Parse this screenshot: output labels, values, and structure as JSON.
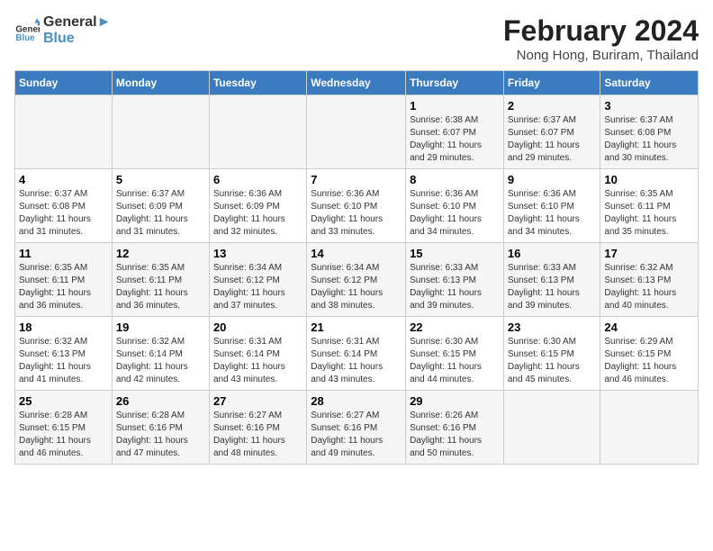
{
  "header": {
    "logo_line1": "General",
    "logo_line2": "Blue",
    "month_year": "February 2024",
    "location": "Nong Hong, Buriram, Thailand"
  },
  "days_of_week": [
    "Sunday",
    "Monday",
    "Tuesday",
    "Wednesday",
    "Thursday",
    "Friday",
    "Saturday"
  ],
  "weeks": [
    [
      {
        "day": "",
        "info": ""
      },
      {
        "day": "",
        "info": ""
      },
      {
        "day": "",
        "info": ""
      },
      {
        "day": "",
        "info": ""
      },
      {
        "day": "1",
        "info": "Sunrise: 6:38 AM\nSunset: 6:07 PM\nDaylight: 11 hours\nand 29 minutes."
      },
      {
        "day": "2",
        "info": "Sunrise: 6:37 AM\nSunset: 6:07 PM\nDaylight: 11 hours\nand 29 minutes."
      },
      {
        "day": "3",
        "info": "Sunrise: 6:37 AM\nSunset: 6:08 PM\nDaylight: 11 hours\nand 30 minutes."
      }
    ],
    [
      {
        "day": "4",
        "info": "Sunrise: 6:37 AM\nSunset: 6:08 PM\nDaylight: 11 hours\nand 31 minutes."
      },
      {
        "day": "5",
        "info": "Sunrise: 6:37 AM\nSunset: 6:09 PM\nDaylight: 11 hours\nand 31 minutes."
      },
      {
        "day": "6",
        "info": "Sunrise: 6:36 AM\nSunset: 6:09 PM\nDaylight: 11 hours\nand 32 minutes."
      },
      {
        "day": "7",
        "info": "Sunrise: 6:36 AM\nSunset: 6:10 PM\nDaylight: 11 hours\nand 33 minutes."
      },
      {
        "day": "8",
        "info": "Sunrise: 6:36 AM\nSunset: 6:10 PM\nDaylight: 11 hours\nand 34 minutes."
      },
      {
        "day": "9",
        "info": "Sunrise: 6:36 AM\nSunset: 6:10 PM\nDaylight: 11 hours\nand 34 minutes."
      },
      {
        "day": "10",
        "info": "Sunrise: 6:35 AM\nSunset: 6:11 PM\nDaylight: 11 hours\nand 35 minutes."
      }
    ],
    [
      {
        "day": "11",
        "info": "Sunrise: 6:35 AM\nSunset: 6:11 PM\nDaylight: 11 hours\nand 36 minutes."
      },
      {
        "day": "12",
        "info": "Sunrise: 6:35 AM\nSunset: 6:11 PM\nDaylight: 11 hours\nand 36 minutes."
      },
      {
        "day": "13",
        "info": "Sunrise: 6:34 AM\nSunset: 6:12 PM\nDaylight: 11 hours\nand 37 minutes."
      },
      {
        "day": "14",
        "info": "Sunrise: 6:34 AM\nSunset: 6:12 PM\nDaylight: 11 hours\nand 38 minutes."
      },
      {
        "day": "15",
        "info": "Sunrise: 6:33 AM\nSunset: 6:13 PM\nDaylight: 11 hours\nand 39 minutes."
      },
      {
        "day": "16",
        "info": "Sunrise: 6:33 AM\nSunset: 6:13 PM\nDaylight: 11 hours\nand 39 minutes."
      },
      {
        "day": "17",
        "info": "Sunrise: 6:32 AM\nSunset: 6:13 PM\nDaylight: 11 hours\nand 40 minutes."
      }
    ],
    [
      {
        "day": "18",
        "info": "Sunrise: 6:32 AM\nSunset: 6:13 PM\nDaylight: 11 hours\nand 41 minutes."
      },
      {
        "day": "19",
        "info": "Sunrise: 6:32 AM\nSunset: 6:14 PM\nDaylight: 11 hours\nand 42 minutes."
      },
      {
        "day": "20",
        "info": "Sunrise: 6:31 AM\nSunset: 6:14 PM\nDaylight: 11 hours\nand 43 minutes."
      },
      {
        "day": "21",
        "info": "Sunrise: 6:31 AM\nSunset: 6:14 PM\nDaylight: 11 hours\nand 43 minutes."
      },
      {
        "day": "22",
        "info": "Sunrise: 6:30 AM\nSunset: 6:15 PM\nDaylight: 11 hours\nand 44 minutes."
      },
      {
        "day": "23",
        "info": "Sunrise: 6:30 AM\nSunset: 6:15 PM\nDaylight: 11 hours\nand 45 minutes."
      },
      {
        "day": "24",
        "info": "Sunrise: 6:29 AM\nSunset: 6:15 PM\nDaylight: 11 hours\nand 46 minutes."
      }
    ],
    [
      {
        "day": "25",
        "info": "Sunrise: 6:28 AM\nSunset: 6:15 PM\nDaylight: 11 hours\nand 46 minutes."
      },
      {
        "day": "26",
        "info": "Sunrise: 6:28 AM\nSunset: 6:16 PM\nDaylight: 11 hours\nand 47 minutes."
      },
      {
        "day": "27",
        "info": "Sunrise: 6:27 AM\nSunset: 6:16 PM\nDaylight: 11 hours\nand 48 minutes."
      },
      {
        "day": "28",
        "info": "Sunrise: 6:27 AM\nSunset: 6:16 PM\nDaylight: 11 hours\nand 49 minutes."
      },
      {
        "day": "29",
        "info": "Sunrise: 6:26 AM\nSunset: 6:16 PM\nDaylight: 11 hours\nand 50 minutes."
      },
      {
        "day": "",
        "info": ""
      },
      {
        "day": "",
        "info": ""
      }
    ]
  ]
}
